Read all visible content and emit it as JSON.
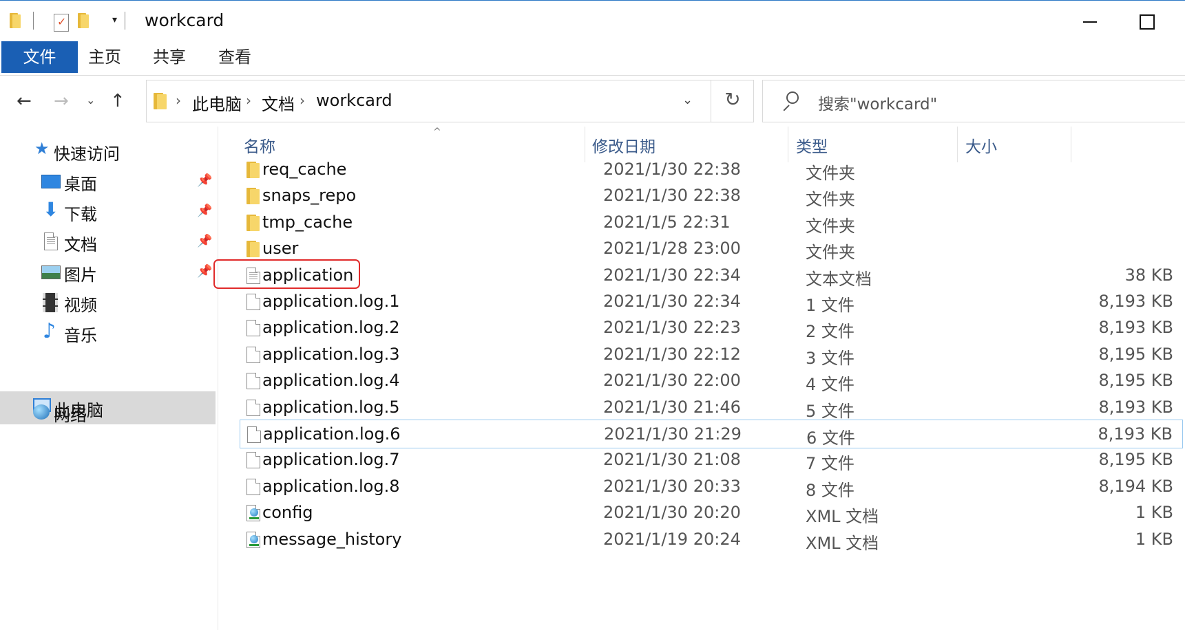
{
  "window": {
    "title": "workcard"
  },
  "ribbon": {
    "tabs": [
      {
        "label": "文件",
        "active": true
      },
      {
        "label": "主页"
      },
      {
        "label": "共享"
      },
      {
        "label": "查看"
      }
    ]
  },
  "address": {
    "crumbs": [
      "此电脑",
      "文档",
      "workcard"
    ],
    "separator": "›"
  },
  "search": {
    "placeholder": "搜索\"workcard\""
  },
  "nav": {
    "quick_access": "快速访问",
    "items": [
      {
        "label": "桌面",
        "icon": "desktop-icon",
        "pinned": true
      },
      {
        "label": "下载",
        "icon": "download-icon",
        "pinned": true
      },
      {
        "label": "文档",
        "icon": "documents-icon",
        "pinned": true
      },
      {
        "label": "图片",
        "icon": "pictures-icon",
        "pinned": true
      },
      {
        "label": "视频",
        "icon": "videos-icon",
        "pinned": false
      },
      {
        "label": "音乐",
        "icon": "music-icon",
        "pinned": false
      }
    ],
    "this_pc": "此电脑",
    "network": "网络"
  },
  "columns": {
    "name": "名称",
    "date": "修改日期",
    "type": "类型",
    "size": "大小"
  },
  "files": [
    {
      "name": "req_cache",
      "date": "2021/1/30 22:38",
      "type": "文件夹",
      "size": "",
      "icon": "folder-icon"
    },
    {
      "name": "snaps_repo",
      "date": "2021/1/30 22:38",
      "type": "文件夹",
      "size": "",
      "icon": "folder-icon"
    },
    {
      "name": "tmp_cache",
      "date": "2021/1/5 22:31",
      "type": "文件夹",
      "size": "",
      "icon": "folder-icon"
    },
    {
      "name": "user",
      "date": "2021/1/28 23:00",
      "type": "文件夹",
      "size": "",
      "icon": "folder-icon"
    },
    {
      "name": "application",
      "date": "2021/1/30 22:34",
      "type": "文本文档",
      "size": "38 KB",
      "icon": "text-file-icon",
      "highlighted": true
    },
    {
      "name": "application.log.1",
      "date": "2021/1/30 22:34",
      "type": "1 文件",
      "size": "8,193 KB",
      "icon": "file-icon"
    },
    {
      "name": "application.log.2",
      "date": "2021/1/30 22:23",
      "type": "2 文件",
      "size": "8,193 KB",
      "icon": "file-icon"
    },
    {
      "name": "application.log.3",
      "date": "2021/1/30 22:12",
      "type": "3 文件",
      "size": "8,195 KB",
      "icon": "file-icon"
    },
    {
      "name": "application.log.4",
      "date": "2021/1/30 22:00",
      "type": "4 文件",
      "size": "8,195 KB",
      "icon": "file-icon"
    },
    {
      "name": "application.log.5",
      "date": "2021/1/30 21:46",
      "type": "5 文件",
      "size": "8,193 KB",
      "icon": "file-icon"
    },
    {
      "name": "application.log.6",
      "date": "2021/1/30 21:29",
      "type": "6 文件",
      "size": "8,193 KB",
      "icon": "file-icon",
      "focused": true
    },
    {
      "name": "application.log.7",
      "date": "2021/1/30 21:08",
      "type": "7 文件",
      "size": "8,195 KB",
      "icon": "file-icon"
    },
    {
      "name": "application.log.8",
      "date": "2021/1/30 20:33",
      "type": "8 文件",
      "size": "8,194 KB",
      "icon": "file-icon"
    },
    {
      "name": "config",
      "date": "2021/1/30 20:20",
      "type": "XML 文档",
      "size": "1 KB",
      "icon": "xml-file-icon"
    },
    {
      "name": "message_history",
      "date": "2021/1/19 20:24",
      "type": "XML 文档",
      "size": "1 KB",
      "icon": "xml-file-icon"
    }
  ],
  "colors": {
    "accent": "#1a5fb4",
    "highlight_box": "#e02a2a",
    "focus_border": "#99c9ef",
    "header_text": "#3a5a8a"
  }
}
